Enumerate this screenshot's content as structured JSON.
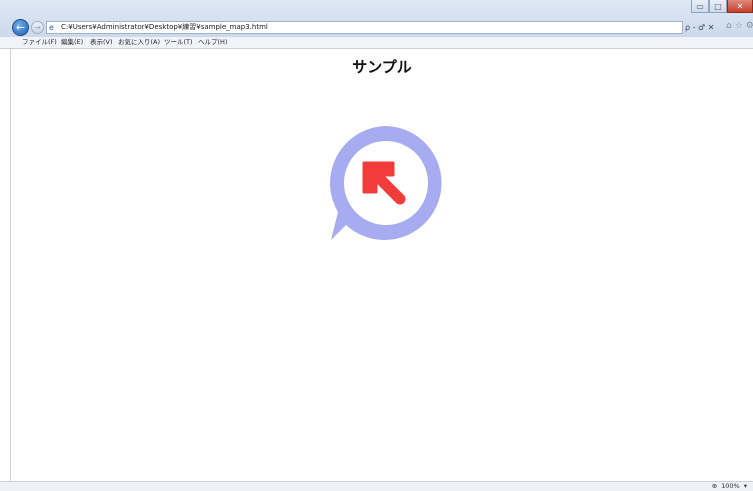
{
  "window": {
    "controls": {
      "minimize": "▭",
      "maximize": "□",
      "close": "✕"
    }
  },
  "address_bar": {
    "url": "C:¥Users¥Administrator¥Desktop¥練習¥sample_map3.html",
    "tools": "ρ - ♂ ✕"
  },
  "menu": [
    {
      "label": "ファイル(F)"
    },
    {
      "label": "編集(E)"
    },
    {
      "label": "表示(V)"
    },
    {
      "label": "お気に入り(A)"
    },
    {
      "label": "ツール(T)"
    },
    {
      "label": "ヘルプ(H)"
    }
  ],
  "page": {
    "title": "サンプル",
    "marker": {
      "ring_color": "#a7abf0",
      "arrow_color": "#f23c3c",
      "icon": "arrow-up-left-icon"
    }
  },
  "status": {
    "zoom": "100%"
  },
  "icons": {
    "back": "←",
    "forward": "→",
    "home": "⌂",
    "favorites": "☆",
    "settings": "⚙",
    "zoom": "🔍"
  }
}
